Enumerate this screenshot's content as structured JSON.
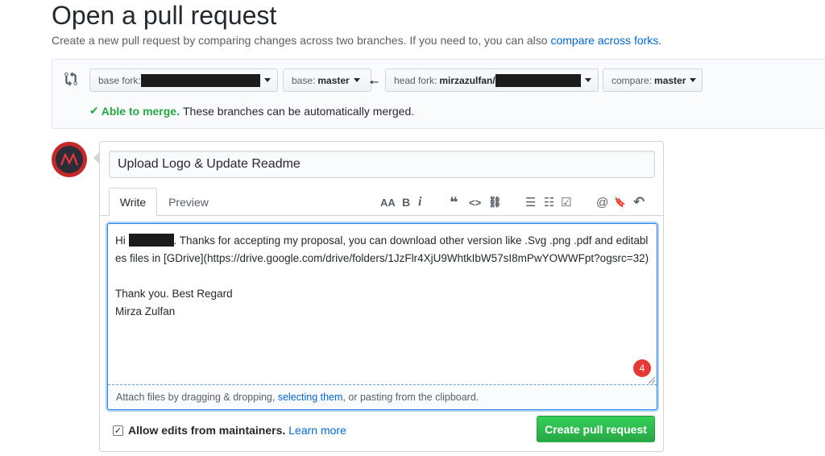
{
  "header": {
    "title": "Open a pull request",
    "subtitle_prefix": "Create a new pull request by comparing changes across two branches. If you need to, you can also ",
    "subtitle_link": "compare across forks",
    "subtitle_suffix": "."
  },
  "range": {
    "base_fork_label": "base fork:",
    "base_label": "base:",
    "base_value": "master",
    "head_fork_label": "head fork:",
    "head_fork_value": "mirzazulfan/",
    "compare_label": "compare:",
    "compare_value": "master",
    "merge_ok": "Able to merge.",
    "merge_msg": "These branches can be automatically merged."
  },
  "form": {
    "title_value": "Upload Logo & Update Readme",
    "tab_write": "Write",
    "tab_preview": "Preview",
    "body_greeting": "Hi ",
    "body_text": ". Thanks for accepting my proposal, you can download other version like .Svg .png .pdf and editables files in [GDrive](https://drive.google.com/drive/folders/1JzFlr4XjU9WhtkIbW57sI8mPwYOWWFpt?ogsrc=32)\n\nThank you. Best Regard\nMirza Zulfan",
    "badge_count": "4",
    "attach_prefix": "Attach files by dragging & dropping, ",
    "attach_link": "selecting them",
    "attach_suffix": ", or pasting from the clipboard.",
    "allow_edits_label": "Allow edits from maintainers.",
    "learn_more": "Learn more",
    "submit_label": "Create pull request"
  },
  "toolbar": {
    "heading": "AA",
    "bold": "B",
    "italic": "i",
    "quote": "❝",
    "code": "<>",
    "link": "⛓",
    "ul": "☰",
    "ol": "☷",
    "task": "☑",
    "mention": "@",
    "ref": "🔖",
    "reply": "↶"
  },
  "colors": {
    "accent": "#0366d6",
    "success": "#28a745",
    "badge": "#e53935"
  }
}
